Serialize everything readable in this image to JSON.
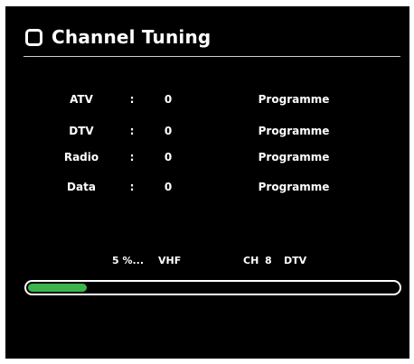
{
  "header": {
    "title": "Channel Tuning",
    "icon": "square-outline-icon"
  },
  "rows": [
    {
      "label": "ATV",
      "colon": ":",
      "count": "0",
      "unit": "Programme"
    },
    {
      "label": "DTV",
      "colon": ":",
      "count": "0",
      "unit": "Programme"
    },
    {
      "label": "Radio",
      "colon": ":",
      "count": "0",
      "unit": "Programme"
    },
    {
      "label": "Data",
      "colon": ":",
      "count": "0",
      "unit": "Programme"
    }
  ],
  "status": {
    "percent_text": "5 %...",
    "band": "VHF",
    "ch_label": "CH",
    "ch_number": "8",
    "type": "DTV"
  },
  "progress": {
    "value_fraction": 0.16
  },
  "colors": {
    "background": "#000000",
    "text": "#ffffff",
    "progress_fill": "#3cb54a"
  }
}
